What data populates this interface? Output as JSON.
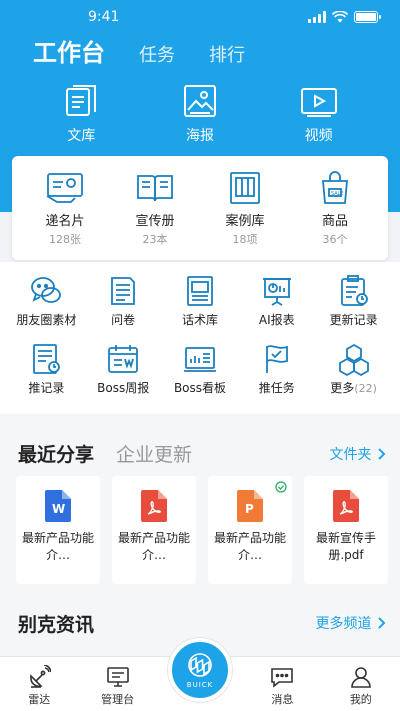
{
  "status": {
    "time": "9:41"
  },
  "tabs": [
    {
      "label": "工作台",
      "active": true
    },
    {
      "label": "任务",
      "active": false
    },
    {
      "label": "排行",
      "active": false
    }
  ],
  "top_features": [
    {
      "label": "文库",
      "icon": "document-icon"
    },
    {
      "label": "海报",
      "icon": "image-icon"
    },
    {
      "label": "视频",
      "icon": "video-icon"
    }
  ],
  "card_items": [
    {
      "label": "递名片",
      "count": "128张",
      "icon": "business-card-icon"
    },
    {
      "label": "宣传册",
      "count": "23本",
      "icon": "brochure-icon"
    },
    {
      "label": "案例库",
      "count": "18项",
      "icon": "case-library-icon"
    },
    {
      "label": "商品",
      "count": "36个",
      "icon": "shopping-bag-icon"
    }
  ],
  "grid_items": [
    {
      "label": "朋友圈素材",
      "icon": "chat-bubble-icon"
    },
    {
      "label": "问卷",
      "icon": "questionnaire-icon"
    },
    {
      "label": "话术库",
      "icon": "script-library-icon"
    },
    {
      "label": "AI报表",
      "icon": "presentation-chart-icon"
    },
    {
      "label": "更新记录",
      "icon": "clipboard-clock-icon"
    },
    {
      "label": "推记录",
      "icon": "record-clock-icon"
    },
    {
      "label": "Boss周报",
      "icon": "calendar-report-icon"
    },
    {
      "label": "Boss看板",
      "icon": "dashboard-icon"
    },
    {
      "label": "推任务",
      "icon": "flag-check-icon"
    },
    {
      "label": "更多",
      "extra": "(22)",
      "icon": "cubes-icon"
    }
  ],
  "recent": {
    "title": "最近分享",
    "subtitle": "企业更新",
    "link": "文件夹",
    "files": [
      {
        "type": "W",
        "color": "#2f6fde",
        "name": "最新产品功能介…",
        "checked": false
      },
      {
        "type": "pdf",
        "color": "#e84c3d",
        "name": "最新产品功能介…",
        "checked": false
      },
      {
        "type": "P",
        "color": "#f07b36",
        "name": "最新产品功能介…",
        "checked": true
      },
      {
        "type": "pdf",
        "color": "#e84c3d",
        "name": "最新宣传手册.pdf",
        "checked": false
      }
    ]
  },
  "news": {
    "title": "别克资讯",
    "link": "更多频道"
  },
  "tabbar": [
    {
      "label": "雷达",
      "icon": "radar-icon"
    },
    {
      "label": "管理台",
      "icon": "console-icon"
    },
    {
      "label": "BUICK",
      "icon": "buick-logo-icon"
    },
    {
      "label": "消息",
      "icon": "message-icon"
    },
    {
      "label": "我的",
      "icon": "user-icon"
    }
  ],
  "colors": {
    "primary": "#1fa3e8",
    "accent_icon": "#1a7fc0"
  }
}
